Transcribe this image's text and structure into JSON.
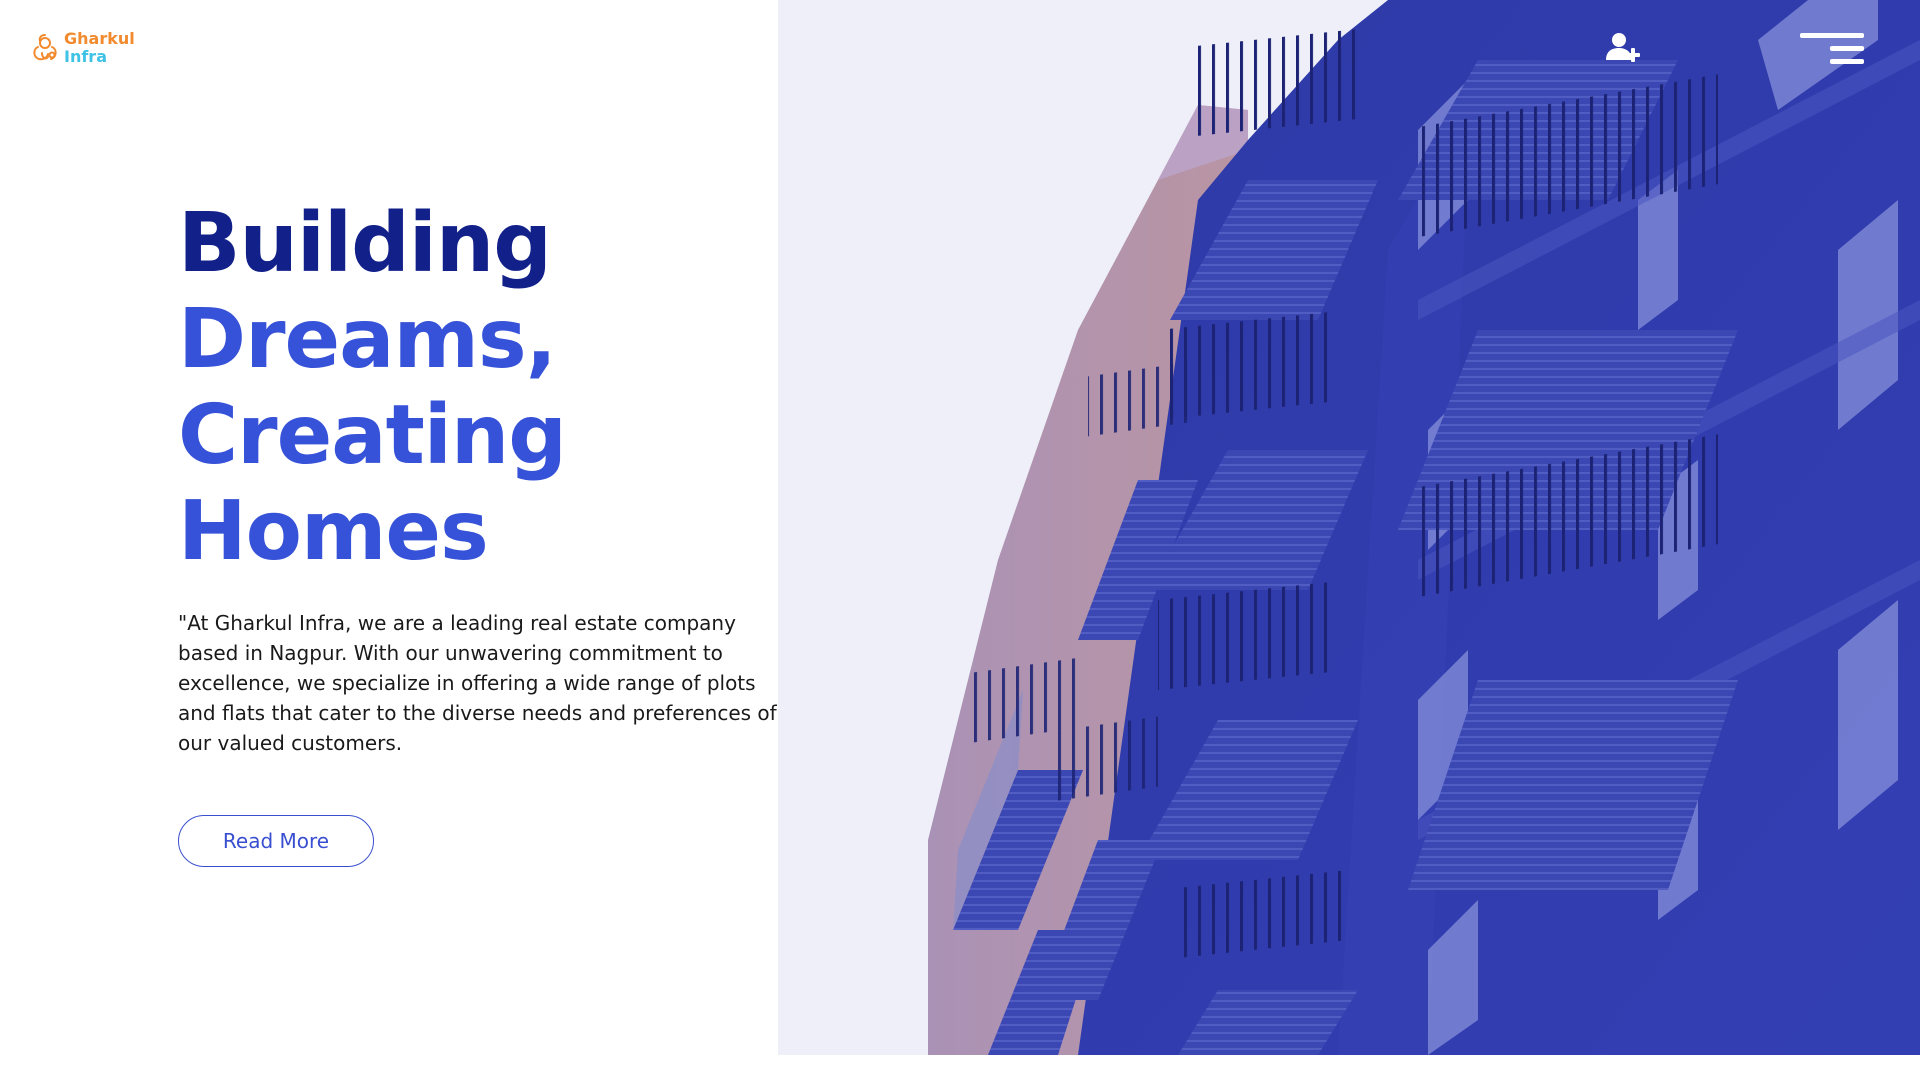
{
  "brand": {
    "line1": "Gharkul",
    "line2": "Infra",
    "color_primary": "#f28a2e",
    "color_secondary": "#3ec3e6",
    "logo_icon": "ganesha-icon"
  },
  "header": {
    "add_user_icon": "add-user-icon",
    "menu_icon": "hamburger-menu-icon"
  },
  "hero": {
    "headline": {
      "line1": "Building",
      "line2": "Dreams,",
      "line3": "Creating",
      "line4": "Homes"
    },
    "description": "\"At Gharkul Infra, we are a leading real estate company based in Nagpur. With our unwavering commitment to excellence, we specialize in offering a wide range of plots and flats that cater to the diverse needs and preferences of our valued customers.",
    "cta_label": "Read More",
    "image_subject": "apartment-building-balconies"
  },
  "colors": {
    "headline_dark": "#12208a",
    "headline_accent": "#3652d8",
    "button_accent": "#3a4fd0",
    "image_tint": "#2e3aa8"
  }
}
